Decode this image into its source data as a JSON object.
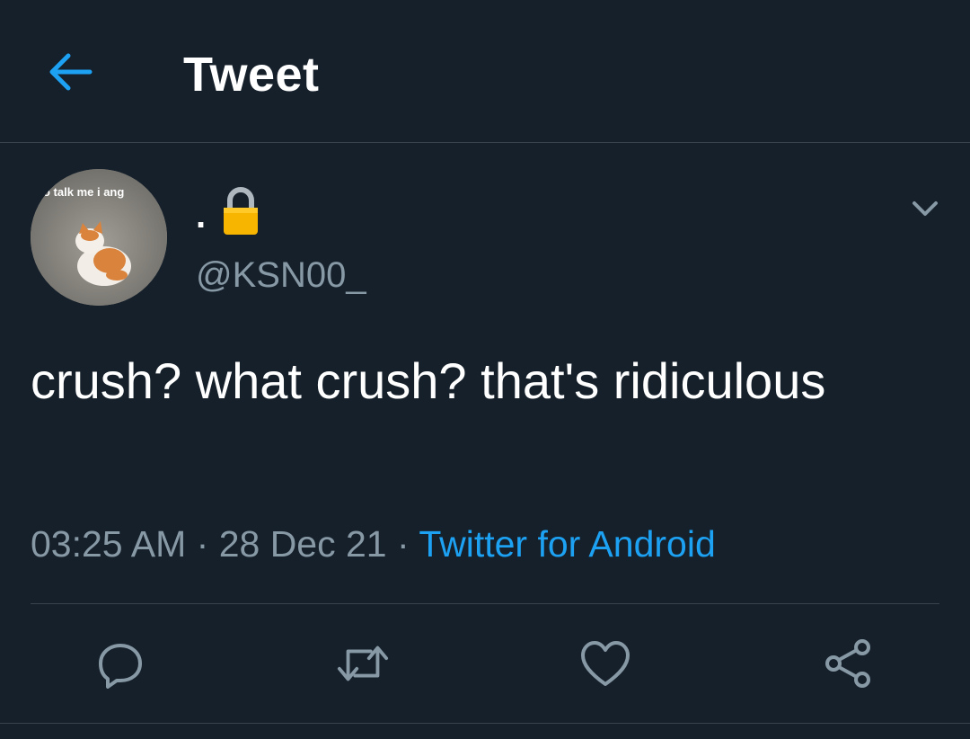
{
  "header": {
    "title": "Tweet",
    "back_icon": "arrow-left-icon"
  },
  "author": {
    "avatar_text": "o talk me i ang",
    "display_name": ".",
    "lock_icon": "lock-emoji-icon",
    "handle": "@KSN00_"
  },
  "tweet": {
    "text": "crush? what crush? that's ridiculous",
    "time": "03:25 AM",
    "separator": "·",
    "date": "28 Dec 21",
    "source": "Twitter for Android"
  },
  "actions": [
    "reply-icon",
    "retweet-icon",
    "like-icon",
    "share-icon"
  ],
  "colors": {
    "background": "#15202b",
    "accent": "#1da1f2",
    "secondary_text": "#8899a6",
    "divider": "#38444d"
  }
}
